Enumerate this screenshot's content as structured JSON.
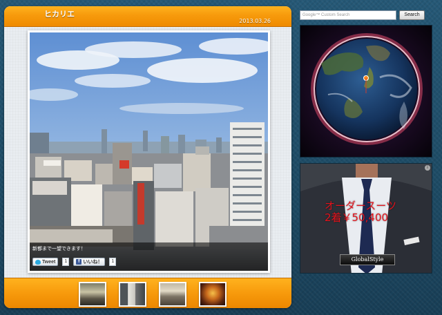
{
  "card": {
    "title": "ヒカリエ",
    "date": "2013.03.26",
    "caption": "新都まで一望できます！",
    "tweet_label": "Tweet",
    "tweet_count": "1",
    "like_label": "いいね！",
    "like_count": "1",
    "thumbnails": [
      "station-thumb",
      "street-thumb",
      "concourse-thumb",
      "shop-thumb"
    ]
  },
  "search": {
    "placeholder": "Google™ Custom Search",
    "button_label": "Search"
  },
  "ad": {
    "line1": "オーダースーツ",
    "line2": "2着￥50,400",
    "brand": "GlobalStyle",
    "text_color": "#e4121b"
  },
  "colors": {
    "header_orange": "#f79a0c",
    "page_blue": "#1e4a63"
  }
}
